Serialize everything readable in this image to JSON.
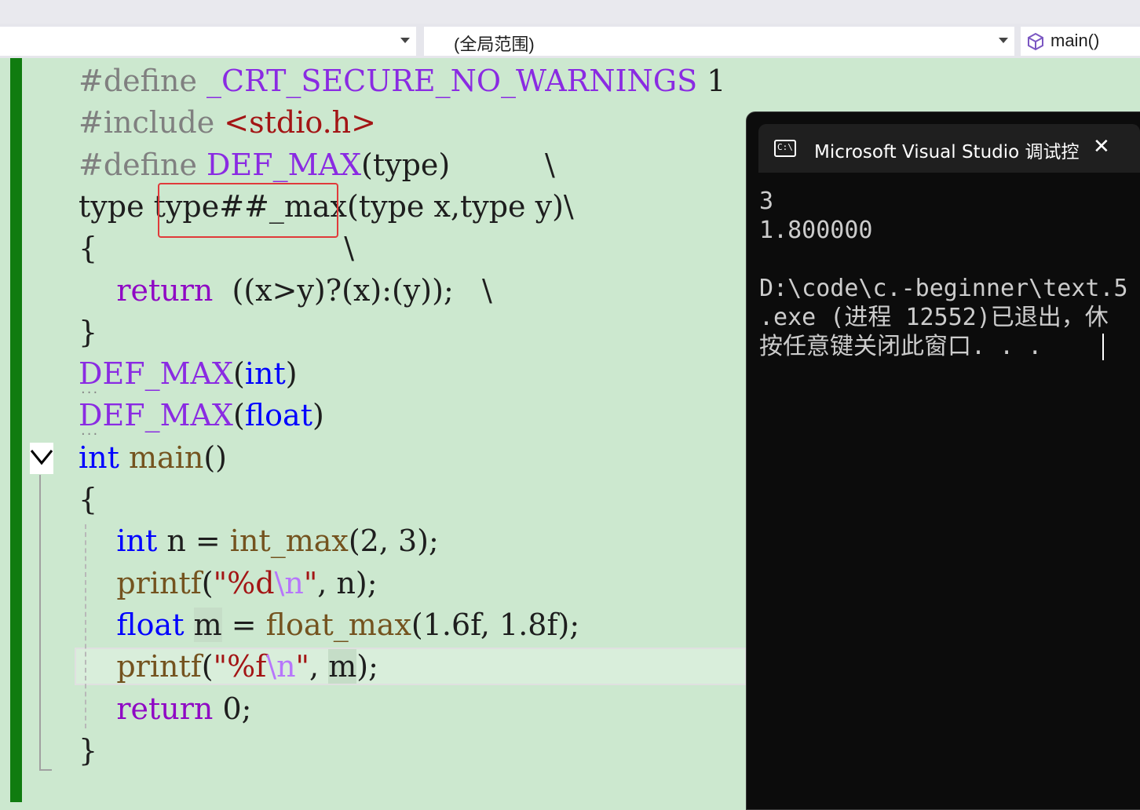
{
  "navbar": {
    "scope_dropdown": "(全局范围)",
    "function_dropdown": "main()"
  },
  "code_lines": [
    {
      "parts": [
        [
          "pp",
          "#define "
        ],
        [
          "mac",
          "_CRT_SECURE_NO_WARNINGS"
        ],
        [
          "num",
          " 1"
        ]
      ]
    },
    {
      "parts": [
        [
          "pp",
          "#include "
        ],
        [
          "str",
          "<stdio.h>"
        ]
      ]
    },
    {
      "parts": [
        [
          "pp",
          "#define "
        ],
        [
          "mac",
          "DEF_MAX"
        ],
        [
          "paren",
          "(type)"
        ],
        [
          "paren",
          "          \\"
        ]
      ]
    },
    {
      "parts": [
        [
          "paren",
          "type "
        ],
        [
          "paren",
          "type##_max"
        ],
        [
          "paren",
          "(type x,type y)\\"
        ]
      ]
    },
    {
      "parts": [
        [
          "paren",
          "{                          \\"
        ]
      ]
    },
    {
      "parts": [
        [
          "paren",
          "    "
        ],
        [
          "ctl",
          "return"
        ],
        [
          "paren",
          "  ((x>y)?(x):(y));   \\"
        ]
      ]
    },
    {
      "parts": [
        [
          "paren",
          "}"
        ]
      ]
    },
    {
      "parts": [
        [
          "mac",
          "DEF_MAX"
        ],
        [
          "paren",
          "("
        ],
        [
          "kw",
          "int"
        ],
        [
          "paren",
          ")"
        ]
      ]
    },
    {
      "parts": [
        [
          "mac",
          "DEF_MAX"
        ],
        [
          "paren",
          "("
        ],
        [
          "kw",
          "float"
        ],
        [
          "paren",
          ")"
        ]
      ]
    },
    {
      "parts": [
        [
          "kw",
          "int"
        ],
        [
          "paren",
          " "
        ],
        [
          "fn",
          "main"
        ],
        [
          "paren",
          "()"
        ]
      ]
    },
    {
      "parts": [
        [
          "paren",
          "{"
        ]
      ]
    },
    {
      "parts": [
        [
          "paren",
          "    "
        ],
        [
          "kw",
          "int"
        ],
        [
          "paren",
          " n = "
        ],
        [
          "fn",
          "int_max"
        ],
        [
          "paren",
          "(2, 3);"
        ]
      ]
    },
    {
      "parts": [
        [
          "paren",
          "    "
        ],
        [
          "fn",
          "printf"
        ],
        [
          "paren",
          "("
        ],
        [
          "str",
          "\"%d"
        ],
        [
          "esc",
          "\\n"
        ],
        [
          "str",
          "\""
        ],
        [
          "paren",
          ", n);"
        ]
      ]
    },
    {
      "parts": [
        [
          "paren",
          "    "
        ],
        [
          "kw",
          "float"
        ],
        [
          "paren",
          " "
        ],
        [
          "mhl",
          "m"
        ],
        [
          "paren",
          " = "
        ],
        [
          "fn",
          "float_max"
        ],
        [
          "paren",
          "(1.6f, 1.8f);"
        ]
      ]
    },
    {
      "parts": [
        [
          "paren",
          "    "
        ],
        [
          "fn",
          "printf"
        ],
        [
          "paren",
          "("
        ],
        [
          "str",
          "\"%f"
        ],
        [
          "esc",
          "\\n"
        ],
        [
          "str",
          "\""
        ],
        [
          "paren",
          ", "
        ],
        [
          "mhl",
          "m"
        ],
        [
          "paren",
          ");"
        ]
      ]
    },
    {
      "parts": [
        [
          "paren",
          "    "
        ],
        [
          "ctl",
          "return"
        ],
        [
          "paren",
          " 0;"
        ]
      ]
    },
    {
      "parts": [
        [
          "paren",
          "}"
        ]
      ]
    }
  ],
  "console": {
    "title": "Microsoft Visual Studio 调试控",
    "icon": "console-icon",
    "close": "✕",
    "output_lines": [
      "3",
      "1.800000",
      "",
      "D:\\code\\c.-beginner\\text.5",
      ".exe (进程 12552)已退出，休",
      "按任意键关闭此窗口. . ."
    ]
  },
  "colors": {
    "editor_bg": "#cce8cf",
    "keyword": "#0000ff",
    "macro": "#8a2be2",
    "preprocessor": "#808080",
    "function": "#74531f",
    "string": "#a31515",
    "control": "#8f08c4",
    "console_bg": "#0c0c0c",
    "change_bar": "#107c10"
  }
}
